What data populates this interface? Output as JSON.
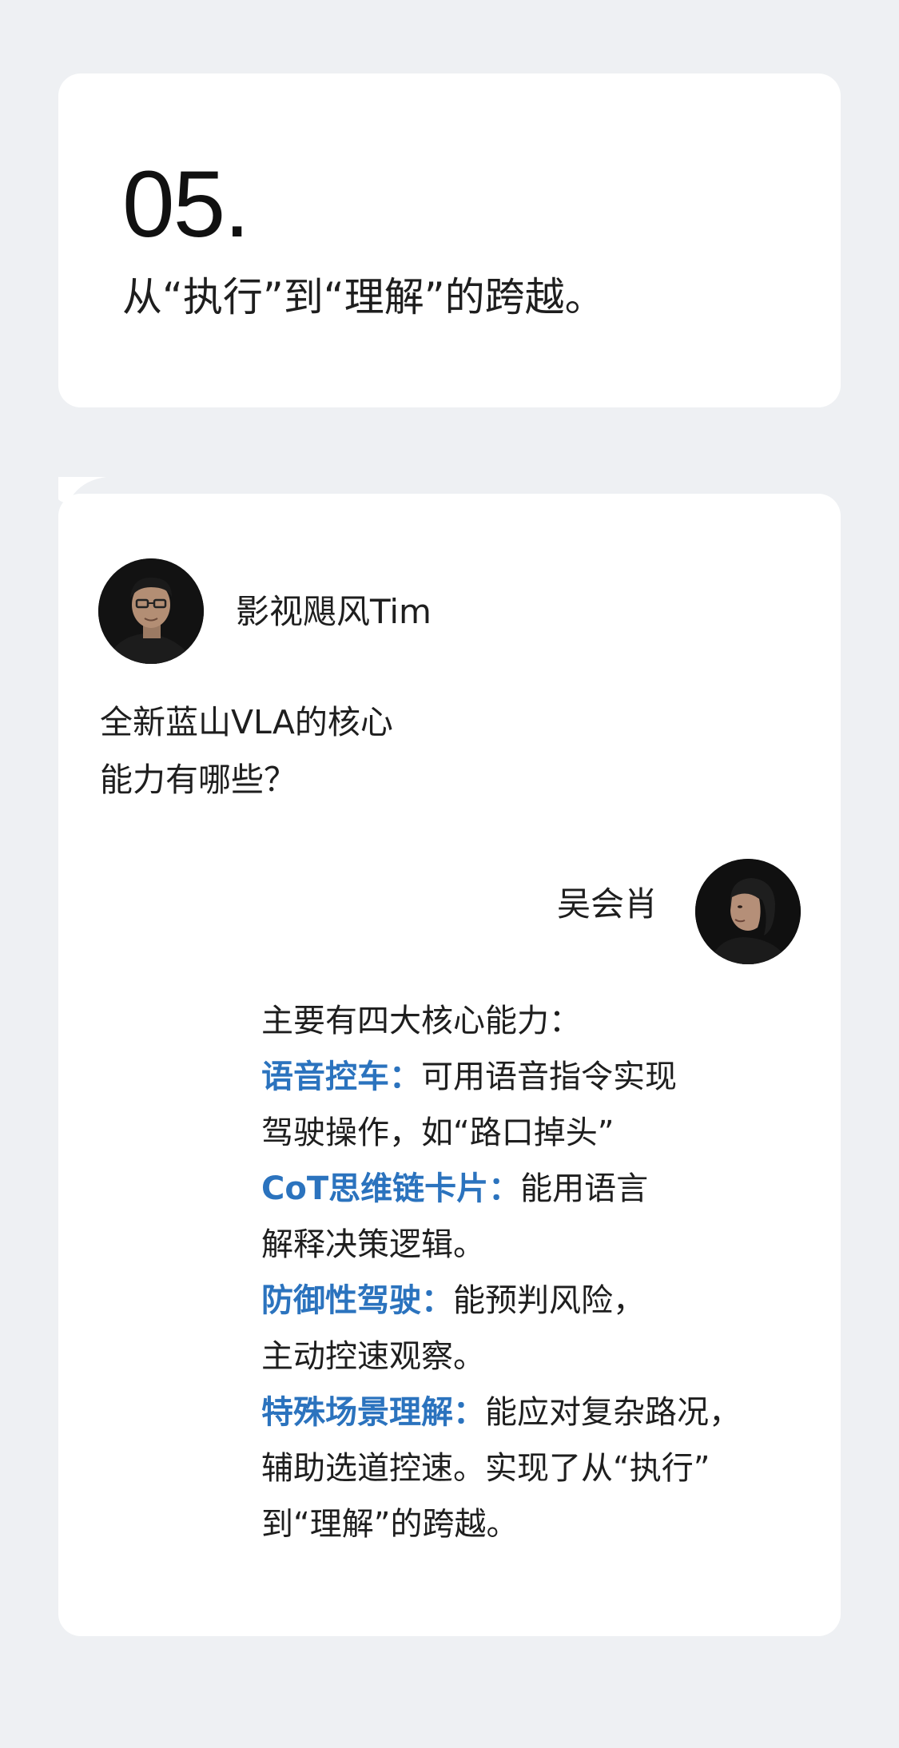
{
  "header": {
    "number": "05.",
    "title": "从“执行”到“理解”的跨越。"
  },
  "interviewer": {
    "name": "影视飓风Tim",
    "question_lines": [
      "全新蓝山VLA的核心",
      "能力有哪些？"
    ]
  },
  "interviewee": {
    "name": "吴会肖"
  },
  "answer": {
    "intro": "主要有四大核心能力：",
    "items": [
      {
        "label": "语音控车：",
        "line1": "可用语音指令实现",
        "line2": "驾驶操作，如“路口掉头”"
      },
      {
        "label": "CoT思维链卡片：",
        "line1": "能用语言",
        "line2": "解释决策逻辑。"
      },
      {
        "label": "防御性驾驶：",
        "line1": "能预判风险，",
        "line2": "主动控速观察。"
      },
      {
        "label": "特殊场景理解：",
        "line1": "能应对复杂路况，",
        "line2": "辅助选道控速。实现了从“执行”",
        "line3": "到“理解”的跨越。"
      }
    ]
  },
  "colors": {
    "background": "#eef0f3",
    "card": "#ffffff",
    "highlight": "#2b73be",
    "text": "#1e1e1e"
  },
  "icons": {
    "interviewer_avatar": "person-avatar-glasses",
    "interviewee_avatar": "person-avatar-profile"
  }
}
